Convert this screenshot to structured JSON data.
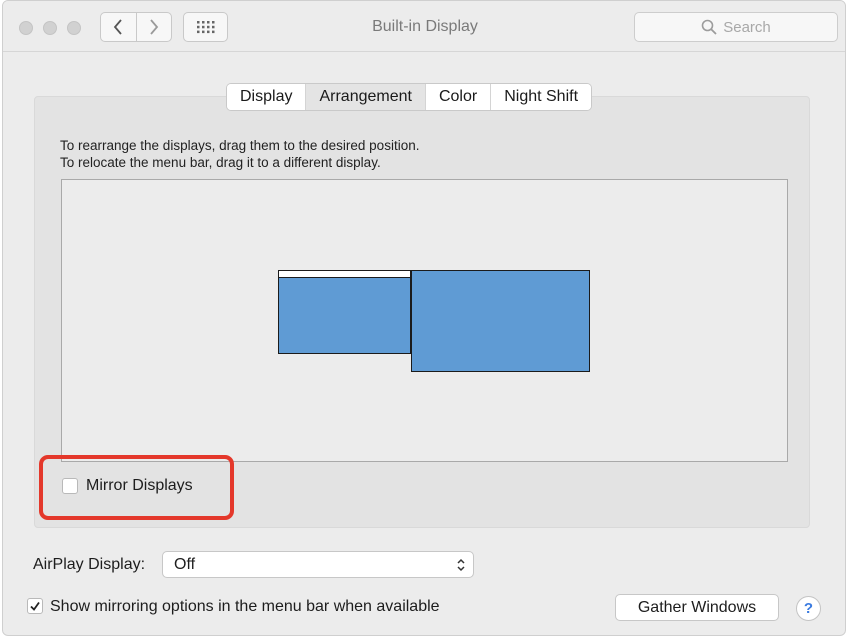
{
  "window": {
    "title": "Built-in Display"
  },
  "search": {
    "placeholder": "Search"
  },
  "tabs": [
    {
      "label": "Display",
      "active": false
    },
    {
      "label": "Arrangement",
      "active": true
    },
    {
      "label": "Color",
      "active": false
    },
    {
      "label": "Night Shift",
      "active": false
    }
  ],
  "instructions": {
    "line1": "To rearrange the displays, drag them to the desired position.",
    "line2": "To relocate the menu bar, drag it to a different display."
  },
  "arrangement": {
    "display_color": "#5f9bd4",
    "displays": [
      {
        "name": "built-in-display",
        "has_menu_bar": true
      },
      {
        "name": "external-display",
        "has_menu_bar": false
      }
    ]
  },
  "mirror": {
    "label": "Mirror Displays",
    "checked": false,
    "highlight_color": "#e4382b"
  },
  "airplay": {
    "label": "AirPlay Display:",
    "value": "Off"
  },
  "show_mirroring": {
    "label": "Show mirroring options in the menu bar when available",
    "checked": true
  },
  "buttons": {
    "gather": "Gather Windows",
    "help": "?"
  }
}
